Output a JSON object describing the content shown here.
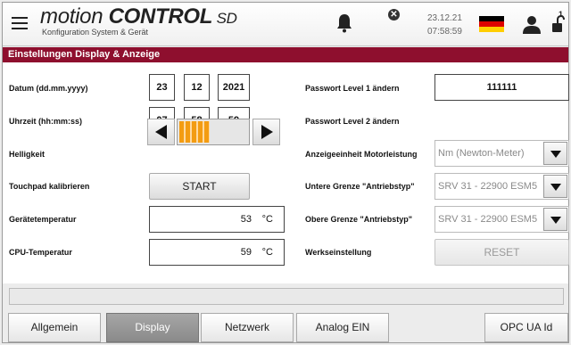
{
  "header": {
    "logo_main_1": "motion ",
    "logo_main_2": "CONTROL",
    "logo_main_3": " SD",
    "logo_sub": "Konfiguration System & Gerät",
    "date": "23.12.21",
    "time": "07:58:59",
    "lock_level": "1",
    "icons": [
      "menu-icon",
      "bell-icon",
      "alarm-x-icon",
      "german-flag-icon",
      "user-icon",
      "unlock-icon"
    ]
  },
  "title": "Einstellungen Display & Anzeige",
  "left": {
    "date_label": "Datum (dd.mm.yyyy)",
    "date_day": "23",
    "date_month": "12",
    "date_year": "2021",
    "time_label": "Uhrzeit (hh:mm:ss)",
    "time_h": "07",
    "time_m": "58",
    "time_s": "59",
    "brightness_label": "Helligkeit",
    "brightness_level": 0.45,
    "touch_label": "Touchpad kalibrieren",
    "touch_button": "START",
    "device_temp_label": "Gerätetemperatur",
    "device_temp_value": "53",
    "device_temp_unit": "°C",
    "cpu_temp_label": "CPU-Temperatur",
    "cpu_temp_value": "59",
    "cpu_temp_unit": "°C"
  },
  "right": {
    "pw1_label": "Passwort Level 1 ändern",
    "pw1_value": "111111",
    "pw2_label": "Passwort Level 2 ändern",
    "unit_label": "Anzeigeeinheit Motorleistung",
    "unit_value": "Nm  (Newton-Meter)",
    "lower_label": "Untere Grenze \"Antriebstyp\"",
    "lower_value": "SRV 31 - 22900 ESM5",
    "upper_label": "Obere Grenze \"Antriebstyp\"",
    "upper_value": "SRV 31 - 22900 ESM5",
    "factory_label": "Werkseinstellung",
    "factory_button": "RESET"
  },
  "tabs": [
    {
      "label": "Allgemein",
      "active": false
    },
    {
      "label": "Display",
      "active": true
    },
    {
      "label": "Netzwerk",
      "active": false
    },
    {
      "label": "Analog EIN",
      "active": false
    },
    {
      "label": "OPC UA Id",
      "active": false
    }
  ],
  "colors": {
    "accent": "#8e0f2e",
    "brightness": "#f39c12"
  }
}
